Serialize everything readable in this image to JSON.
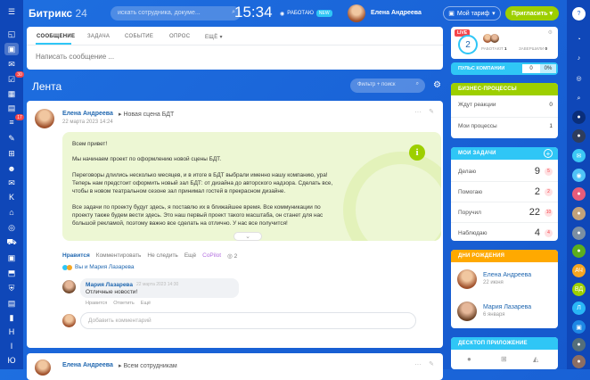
{
  "app": {
    "logo": "Битрикс",
    "logo_num": "24",
    "search_placeholder": "искать сотрудника, докуме...",
    "clock": "15:34",
    "work_status": "РАБОТАЮ",
    "work_badge": "NEW",
    "user_name": "Елена Андреева",
    "tariff_label": "Мой тариф",
    "invite_label": "Пригласить",
    "help": "?"
  },
  "left_nav": {
    "badges": [
      "30",
      "17"
    ],
    "letters": [
      "K",
      "Н",
      "I",
      "Ю"
    ]
  },
  "composer": {
    "tabs": [
      "СООБЩЕНИЕ",
      "ЗАДАЧА",
      "СОБЫТИЕ",
      "ОПРОС",
      "ЕЩЁ"
    ],
    "placeholder": "Написать сообщение ..."
  },
  "feed": {
    "title": "Лента",
    "filter_placeholder": "Фильтр + поиск"
  },
  "post": {
    "author": "Елена Андреева",
    "target": "Новая сцена БДТ",
    "date": "22 марта 2023 14:24",
    "lines": [
      "Всем привет!",
      "Мы начинаем проект по оформлению новой сцены БДТ.",
      "Переговоры длились несколько месяцев, и в итоге в БДТ выбрали именно нашу компанию, ура!",
      "Теперь нам предстоит оформить новый зал БДТ: от дизайна до авторского надзора. Сделать все,",
      "чтобы в новом театральном сезоне зал принимал гостей в прекрасном дизайне.",
      "Все задачи по проекту будут здесь, я поставлю их в ближайшее время. Все коммуникации по",
      "проекту также будем вести здесь. Это наш первый проект такого масштаба, он станет для нас",
      "большой рекламой, поэтому важно все сделать на отлично. У нас все получится!"
    ],
    "actions": [
      "Нравится",
      "Комментировать",
      "Не следить",
      "Ещё",
      "CoPilot",
      "2"
    ],
    "likes": "Вы и Мария Лазарева",
    "comment": {
      "author": "Мария Лазарева",
      "date": "22 марта 2023 14:30",
      "text": "Отличные новости!",
      "actions": [
        "Нравится",
        "Ответить",
        "Ещё"
      ]
    },
    "add_comment": "Добавить комментарий"
  },
  "post2": {
    "author": "Елена Андреева",
    "target": "Всем сотрудникам"
  },
  "right": {
    "live": "LIVE",
    "working": {
      "count": "2",
      "label_working": "РАБОТАЮТ",
      "working_num": "1",
      "label_done": "ЗАВЕРШИЛИ",
      "done_num": "0"
    },
    "pulse": {
      "label": "ПУЛЬС КОМПАНИИ",
      "value": "0",
      "percent": "0%"
    },
    "bp": {
      "title": "БИЗНЕС-ПРОЦЕССЫ",
      "rows": [
        {
          "label": "Ждут реакции",
          "value": "0"
        },
        {
          "label": "Мои процессы",
          "value": "1"
        }
      ]
    },
    "tasks": {
      "title": "МОИ ЗАДАЧИ",
      "rows": [
        {
          "label": "Делаю",
          "value": "9",
          "badge": "5"
        },
        {
          "label": "Помогаю",
          "value": "2",
          "badge": "2"
        },
        {
          "label": "Поручил",
          "value": "22",
          "badge": "10"
        },
        {
          "label": "Наблюдаю",
          "value": "4",
          "badge": "4"
        }
      ]
    },
    "birthdays": {
      "title": "ДНИ РОЖДЕНИЯ",
      "people": [
        {
          "name": "Елена Андреева",
          "date": "22 июня"
        },
        {
          "name": "Мария Лазарева",
          "date": "6 января"
        }
      ]
    },
    "desktop": {
      "title": "ДЕСКТОП ПРИЛОЖЕНИЕ"
    }
  },
  "right_nav": {
    "letters": [
      "АЧ",
      "ВД",
      "Л"
    ]
  }
}
